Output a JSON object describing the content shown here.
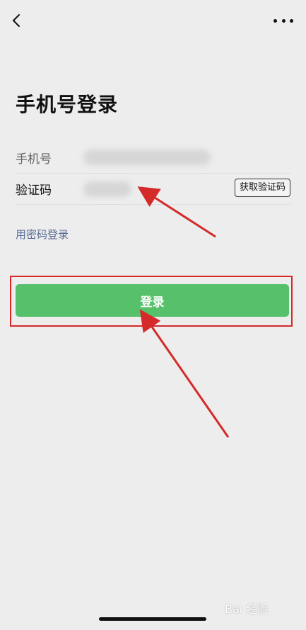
{
  "header": {
    "back_icon": "chevron-left-icon",
    "more_icon": "more-dots-icon"
  },
  "page_title": "手机号登录",
  "form": {
    "phone_label": "手机号",
    "code_label": "验证码",
    "get_code_button": "获取验证码"
  },
  "password_login_link": "用密码登录",
  "login_button": "登录",
  "colors": {
    "primary_green": "#57c06a",
    "link_blue": "#576b95",
    "annotation_red": "#d42a2a"
  },
  "watermark": "Bai 经验"
}
